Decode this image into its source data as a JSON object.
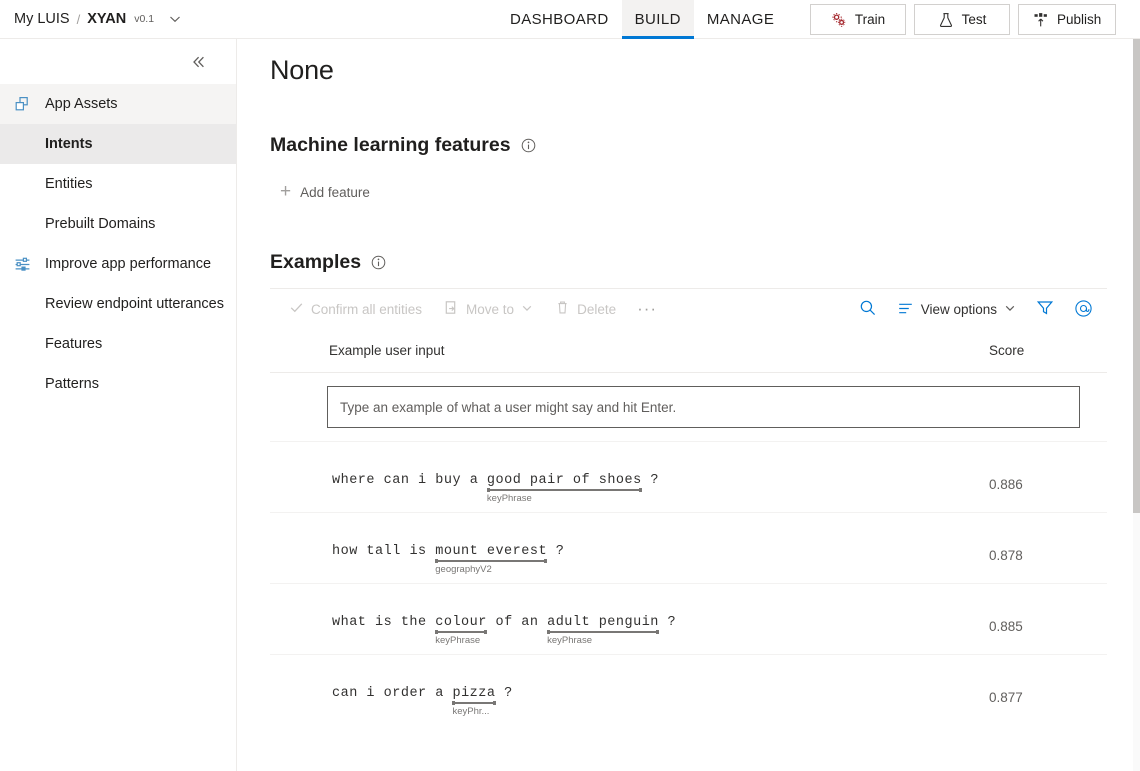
{
  "topbar": {
    "breadcrumb": {
      "root": "My LUIS",
      "separator": "/",
      "app_name": "XYAN",
      "version": "v0.1",
      "chevron_icon": "chevron-down-icon"
    },
    "tabs": [
      {
        "label": "DASHBOARD",
        "active": false
      },
      {
        "label": "BUILD",
        "active": true
      },
      {
        "label": "MANAGE",
        "active": false
      }
    ],
    "actions": [
      {
        "label": "Train",
        "icon": "gears-icon",
        "color": "#a4262c"
      },
      {
        "label": "Test",
        "icon": "flask-icon",
        "color": "#323130"
      },
      {
        "label": "Publish",
        "icon": "publish-upload-icon",
        "color": "#323130"
      }
    ]
  },
  "sidebar": {
    "collapse_icon": "double-chevron-left-icon",
    "items": [
      {
        "label": "App Assets",
        "icon": "layers-icon",
        "kind": "group",
        "selected": false
      },
      {
        "label": "Intents",
        "icon": "",
        "kind": "child",
        "selected": true
      },
      {
        "label": "Entities",
        "icon": "",
        "kind": "child",
        "selected": false
      },
      {
        "label": "Prebuilt Domains",
        "icon": "",
        "kind": "child",
        "selected": false
      },
      {
        "label": "Improve app performance",
        "icon": "sliders-icon",
        "kind": "group-plain",
        "selected": false
      },
      {
        "label": "Review endpoint utterances",
        "icon": "",
        "kind": "child",
        "selected": false
      },
      {
        "label": "Features",
        "icon": "",
        "kind": "child",
        "selected": false
      },
      {
        "label": "Patterns",
        "icon": "",
        "kind": "child",
        "selected": false
      }
    ]
  },
  "main": {
    "page_title": "None",
    "ml_features": {
      "heading": "Machine learning features",
      "info_icon": "info-circle-icon",
      "add_feature_label": "Add feature",
      "add_icon": "plus-icon"
    },
    "examples": {
      "heading": "Examples",
      "info_icon": "info-circle-icon",
      "toolbar_left": [
        {
          "label": "Confirm all entities",
          "icon": "check-icon",
          "disabled": true
        },
        {
          "label": "Move to",
          "icon": "move-to-icon",
          "chevron": "chevron-down-icon",
          "disabled": true
        },
        {
          "label": "Delete",
          "icon": "trash-icon",
          "disabled": true
        },
        {
          "label": "···",
          "icon": "more-icon",
          "disabled": false
        }
      ],
      "toolbar_right": [
        {
          "label": "",
          "icon": "search-icon"
        },
        {
          "label": "View options",
          "icon": "view-options-icon",
          "chevron": "chevron-down-icon"
        },
        {
          "label": "",
          "icon": "filter-icon"
        },
        {
          "label": "",
          "icon": "at-mention-icon"
        }
      ],
      "columns": {
        "utterance": "Example user input",
        "score": "Score"
      },
      "new_utterance_placeholder": "Type an example of what a user might say and hit Enter.",
      "new_utterance_value": "",
      "rows": [
        {
          "score": "0.886",
          "tokens": [
            {
              "text": "where",
              "entity": null
            },
            {
              "text": "can",
              "entity": null
            },
            {
              "text": "i",
              "entity": null
            },
            {
              "text": "buy",
              "entity": null
            },
            {
              "text": "a",
              "entity": null
            },
            {
              "text": "good pair of shoes",
              "entity": "keyPhrase"
            },
            {
              "text": "?",
              "entity": null
            }
          ]
        },
        {
          "score": "0.878",
          "tokens": [
            {
              "text": "how",
              "entity": null
            },
            {
              "text": "tall",
              "entity": null
            },
            {
              "text": "is",
              "entity": null
            },
            {
              "text": "mount everest",
              "entity": "geographyV2"
            },
            {
              "text": "?",
              "entity": null
            }
          ]
        },
        {
          "score": "0.885",
          "tokens": [
            {
              "text": "what",
              "entity": null
            },
            {
              "text": "is",
              "entity": null
            },
            {
              "text": "the",
              "entity": null
            },
            {
              "text": "colour",
              "entity": "keyPhrase"
            },
            {
              "text": "of",
              "entity": null
            },
            {
              "text": "an",
              "entity": null
            },
            {
              "text": "adult penguin",
              "entity": "keyPhrase"
            },
            {
              "text": "?",
              "entity": null
            }
          ]
        },
        {
          "score": "0.877",
          "tokens": [
            {
              "text": "can",
              "entity": null
            },
            {
              "text": "i",
              "entity": null
            },
            {
              "text": "order",
              "entity": null
            },
            {
              "text": "a",
              "entity": null
            },
            {
              "text": "pizza",
              "entity": "keyPhr..."
            },
            {
              "text": "?",
              "entity": null
            }
          ]
        }
      ]
    }
  },
  "colors": {
    "accent": "#0078d4",
    "train_icon": "#a4262c",
    "selected_bg": "#ebeaea",
    "group_bg": "#f5f4f3",
    "disabled_text": "#c8c6c4"
  }
}
